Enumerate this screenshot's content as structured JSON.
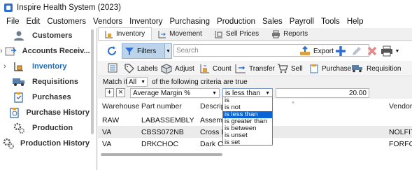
{
  "window": {
    "title": "Inspire Health System (2023)"
  },
  "menu": [
    "File",
    "Edit",
    "Customers",
    "Vendors",
    "Inventory",
    "Purchasing",
    "Production",
    "Sales",
    "Payroll",
    "Tools",
    "Help"
  ],
  "sidebar": {
    "items": [
      {
        "label": "Customers",
        "icon": "customers-icon",
        "expand": ""
      },
      {
        "label": "Accounts Receiv...",
        "icon": "accounts-receivable-icon",
        "expand": "›"
      },
      {
        "label": "Inventory",
        "icon": "inventory-icon",
        "expand": "›",
        "active": true
      },
      {
        "label": "Requisitions",
        "icon": "truck-icon",
        "expand": ""
      },
      {
        "label": "Purchases",
        "icon": "clipboard-icon",
        "expand": ""
      },
      {
        "label": "Purchase History",
        "icon": "clipboard-history-icon",
        "expand": ""
      },
      {
        "label": "Production",
        "icon": "gear-icon",
        "expand": ""
      },
      {
        "label": "Production History",
        "icon": "gear-history-icon",
        "expand": ""
      }
    ]
  },
  "tabs": [
    "Inventory",
    "Movement",
    "Sell Prices",
    "Reports"
  ],
  "toolbar": {
    "filters_label": "Filters",
    "search_placeholder": "Search",
    "export_label": "Export"
  },
  "actions": [
    "Labels",
    "Adjust",
    "Count",
    "Transfer",
    "Sell",
    "Purchase",
    "Requisition"
  ],
  "filter": {
    "match_if": "Match if",
    "match_value": "All",
    "match_rest": "of the following criteria are true",
    "add": "+",
    "remove": "×",
    "field": "Average Margin %",
    "operator": "is less than",
    "value": "20.00"
  },
  "operator_options": [
    "is",
    "is not",
    "is less than",
    "is greater than",
    "is between",
    "is unset",
    "is set"
  ],
  "operator_selected_index": 2,
  "grid": {
    "columns": [
      "Warehouse",
      "Part number",
      "Descrip",
      "Vendor"
    ],
    "rows": [
      [
        "RAW",
        "LABASSEMBLY",
        "Assemb",
        ""
      ],
      [
        "VA",
        "CBSS072NB",
        "Cross Be",
        "NOLFIT"
      ],
      [
        "VA",
        "DRKCHOC",
        "Dark Ch",
        "FORFOO"
      ]
    ]
  },
  "colors": {
    "accent": "#1f6fb8",
    "selection": "#0a64d6",
    "filters_active": "#bcd3ea"
  }
}
